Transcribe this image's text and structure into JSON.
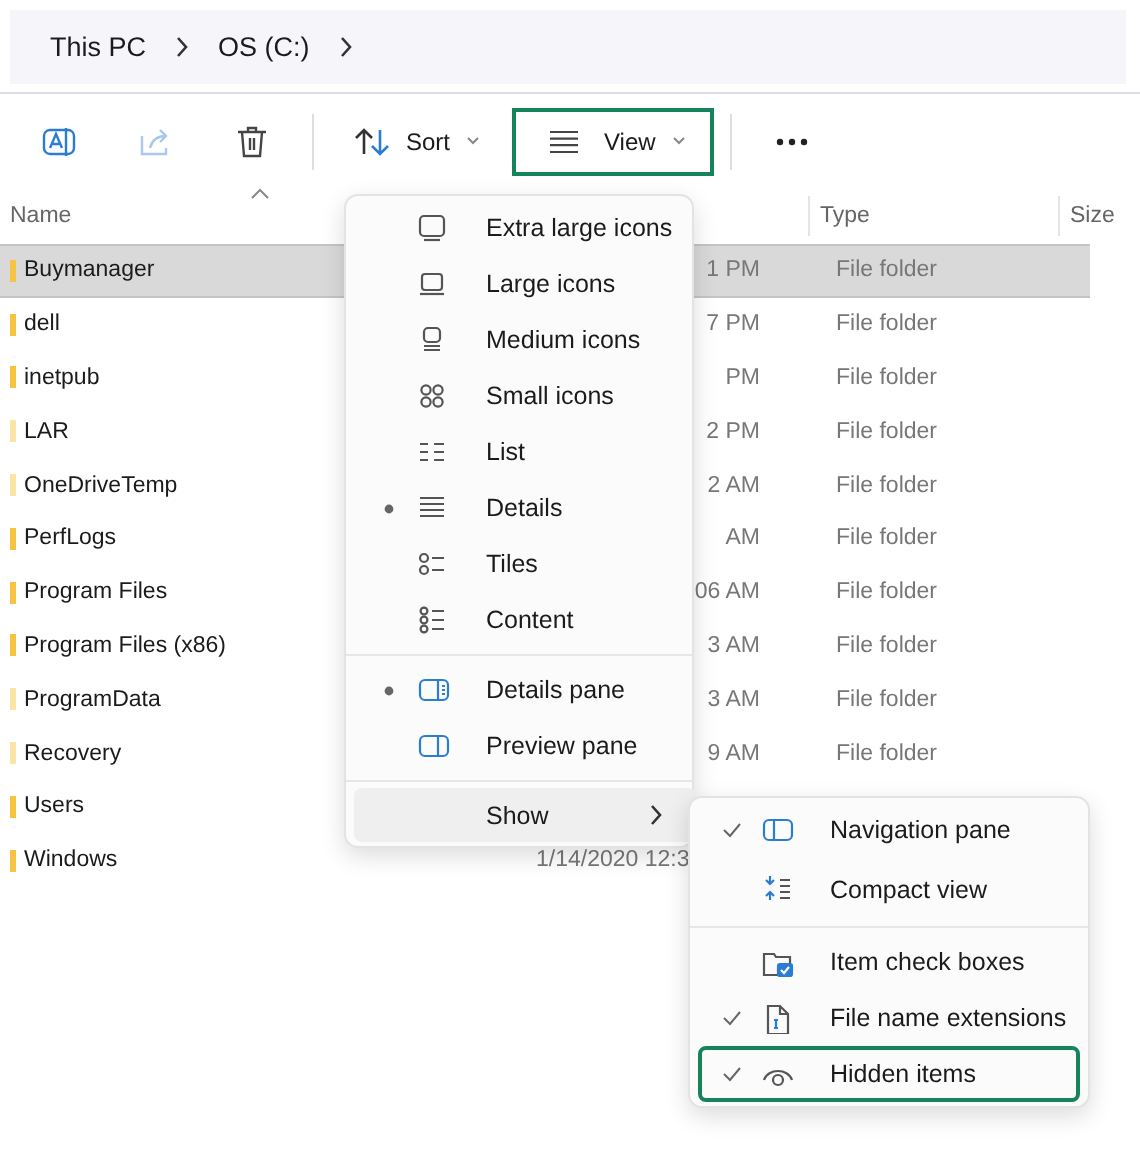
{
  "breadcrumb": [
    "This PC",
    "OS (C:)"
  ],
  "toolbar": {
    "share_disabled": true,
    "sort": {
      "label": "Sort"
    },
    "view": {
      "label": "View",
      "highlighted": true
    }
  },
  "table": {
    "columns": [
      "Name",
      "Type",
      "Size"
    ],
    "rows": [
      {
        "name": "Buymanager",
        "date": "1 PM",
        "type": "File folder",
        "selected": true,
        "hidden": false
      },
      {
        "name": "dell",
        "date": "7 PM",
        "type": "File folder",
        "selected": false,
        "hidden": false
      },
      {
        "name": "inetpub",
        "date": "PM",
        "type": "File folder",
        "selected": false,
        "hidden": false
      },
      {
        "name": "LAR",
        "date": "2 PM",
        "type": "File folder",
        "selected": false,
        "hidden": true
      },
      {
        "name": "OneDriveTemp",
        "date": "2 AM",
        "type": "File folder",
        "selected": false,
        "hidden": true
      },
      {
        "name": "PerfLogs",
        "date": "AM",
        "type": "File folder",
        "selected": false,
        "hidden": false
      },
      {
        "name": "Program Files",
        "date": "06 AM",
        "type": "File folder",
        "selected": false,
        "hidden": false
      },
      {
        "name": "Program Files (x86)",
        "date": "3 AM",
        "type": "File folder",
        "selected": false,
        "hidden": false
      },
      {
        "name": "ProgramData",
        "date": "3 AM",
        "type": "File folder",
        "selected": false,
        "hidden": true
      },
      {
        "name": "Recovery",
        "date": "9 AM",
        "type": "File folder",
        "selected": false,
        "hidden": true
      },
      {
        "name": "Users",
        "selected": false,
        "hidden": false
      },
      {
        "name": "Windows",
        "date": "1/14/2020 12:3",
        "selected": false,
        "hidden": false
      }
    ]
  },
  "view_menu": {
    "groups": [
      [
        {
          "label": "Extra large icons",
          "selected": false
        },
        {
          "label": "Large icons",
          "selected": false
        },
        {
          "label": "Medium icons",
          "selected": false
        },
        {
          "label": "Small icons",
          "selected": false
        },
        {
          "label": "List",
          "selected": false
        },
        {
          "label": "Details",
          "selected": true
        },
        {
          "label": "Tiles",
          "selected": false
        },
        {
          "label": "Content",
          "selected": false
        }
      ],
      [
        {
          "label": "Details pane",
          "selected": true
        },
        {
          "label": "Preview pane",
          "selected": false
        }
      ]
    ],
    "show": {
      "label": "Show",
      "expanded": true
    }
  },
  "show_menu": {
    "groups": [
      [
        {
          "label": "Navigation pane",
          "checked": true,
          "highlighted": false
        },
        {
          "label": "Compact view",
          "checked": false,
          "highlighted": false
        }
      ],
      [
        {
          "label": "Item check boxes",
          "checked": false,
          "highlighted": false
        },
        {
          "label": "File name extensions",
          "checked": true,
          "highlighted": false
        },
        {
          "label": "Hidden items",
          "checked": true,
          "highlighted": true
        }
      ]
    ]
  }
}
